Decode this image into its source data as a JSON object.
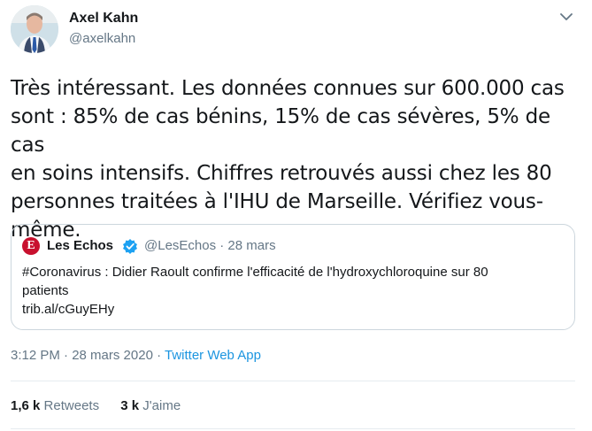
{
  "author": {
    "name": "Axel Kahn",
    "handle": "@axelkahn"
  },
  "tweet": {
    "line1": "Très intéressant. Les données connues sur 600.000 cas",
    "line2": "sont : 85% de cas bénins, 15% de cas sévères, 5% de cas",
    "line3": "en soins intensifs. Chiffres retrouvés aussi chez les 80",
    "line4": "personnes traitées à l'IHU de Marseille. Vérifiez vous-",
    "line5": "même."
  },
  "quote": {
    "logo_letter": "E",
    "name": "Les Echos",
    "handle_date": "@LesEchos · 28 mars",
    "line1": "#Coronavirus : Didier Raoult confirme l'efficacité de l'hydroxychloroquine sur 80",
    "line2": "patients",
    "link": "trib.al/cGuyEHy"
  },
  "meta": {
    "timestamp": "3:12 PM · 28 mars 2020 · ",
    "app": "Twitter Web App"
  },
  "stats": {
    "retweets_count": "1,6 k",
    "retweets_label": "Retweets",
    "likes_count": "3 k",
    "likes_label": "J'aime"
  },
  "icons": {
    "menu": "chevron-down-icon",
    "verified": "verified-badge-icon"
  },
  "colors": {
    "accent": "#1b95e0",
    "verified": "#1da1f2",
    "echos_red": "#c8102e",
    "secondary_text": "#657786"
  }
}
